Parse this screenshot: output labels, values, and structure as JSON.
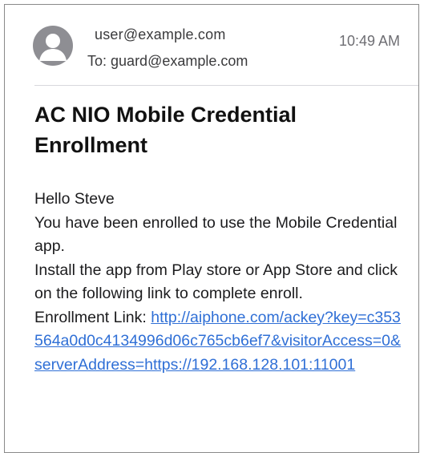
{
  "email": {
    "sender": "user@example.com",
    "to_label": "To:",
    "recipient": "guard@example.com",
    "time": "10:49 AM",
    "subject": "AC NIO Mobile Credential Enrollment",
    "greeting": "Hello Steve",
    "line1": "You have been enrolled to use the Mobile Credential app.",
    "line2": "Install the app from Play store or App Store and click on the following link to complete enroll.",
    "link_label": "Enrollment Link:",
    "link_url": "http://aiphone.com/ackey?key=c353564a0d0c4134996d06c765cb6ef7&visitorAccess=0&serverAddress=https://192.168.128.101:11001"
  },
  "colors": {
    "link": "#2f6fd6",
    "avatar": "#8e8e93",
    "text": "#1c1c1e"
  },
  "icons": {
    "avatar": "person-avatar-icon"
  }
}
